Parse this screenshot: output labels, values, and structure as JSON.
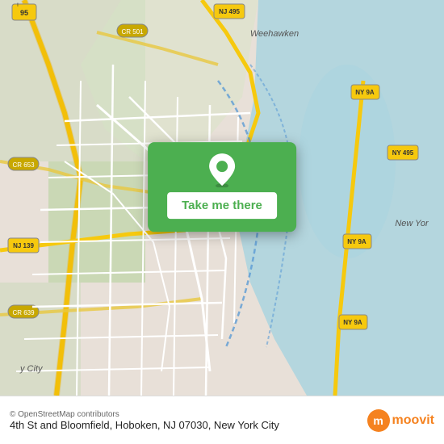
{
  "map": {
    "background_color": "#e8e0d8",
    "water_color": "#aad3df",
    "road_color": "#ffffff",
    "highway_color": "#f6c90e",
    "green_color": "#b5d29e"
  },
  "popup": {
    "background_color": "#4caf50",
    "button_label": "Take me there",
    "pin_icon": "location-pin-icon"
  },
  "bottom_bar": {
    "credit": "© OpenStreetMap contributors",
    "address": "4th St and Bloomfield, Hoboken, NJ 07030, New York City",
    "logo_letter": "m",
    "logo_text": "moovit"
  }
}
